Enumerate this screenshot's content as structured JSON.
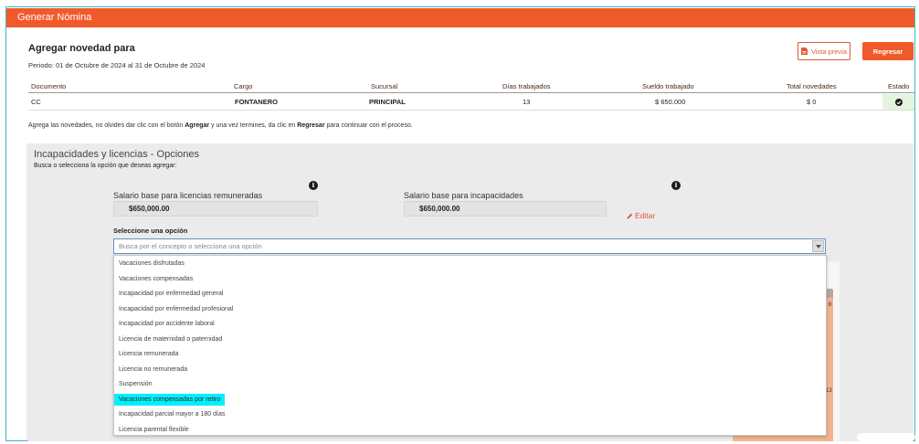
{
  "header": {
    "title": "Generar Nómina"
  },
  "summary": {
    "title": "Agregar novedad para",
    "period": "Periodo: 01 de Octubre de 2024 al 31 de Octubre de 2024",
    "preview_button": "Vista previa",
    "return_button": "Regresar"
  },
  "table": {
    "headers": [
      "Documento",
      "Cargo",
      "Sucursal",
      "Días trabajados",
      "Sueldo trabajado",
      "Total novedades",
      "Estado"
    ],
    "row": [
      "CC",
      "FONTANERO",
      "PRINCIPAL",
      "13",
      "$ 650.000",
      "$ 0"
    ],
    "status": "ok"
  },
  "note": {
    "part1": "Agrega las novedades, no olvides dar clic con el botón ",
    "agregar": "Agregar",
    "part2": " y una vez termines, da clic en ",
    "regresar": "Regresar",
    "part3": " para continuar con el proceso."
  },
  "panel": {
    "title": "Incapacidades y licencias - Opciones",
    "subtitle": "Busca o selecciona la opción que deseas agregar:",
    "salary_licenses_label": "Salario base para licencias remuneradas",
    "salary_licenses_value": "$650,000.00",
    "salary_disability_label": "Salario base para incapacidades",
    "salary_disability_value": "$650,000.00",
    "edit_label": "Editar",
    "select_label": "Seleccione una opción",
    "select_placeholder": "Busca por el concepto o selecciona una opción"
  },
  "options": [
    "Vacaciones disfrutadas",
    "Vacaciones compensadas",
    "Incapacidad por enfermedad general",
    "Incapacidad por enfermedad profesional",
    "Incapacidad por accidente laboral",
    "Licencia de maternidad o paternidad",
    "Licencia remunerada",
    "Licencia no remunerada",
    "Suspensión",
    "Vacaciones compensadas por retiro",
    "Incapacidad parcial mayor a 180 días",
    "Licencia parental flexible"
  ],
  "highlighted_option": "Vacaciones compensadas por retiro",
  "background_numbers": [
    "6",
    "13"
  ],
  "colors": {
    "accent": "#f05a2a",
    "highlight": "#00f0ff",
    "frame": "#3cb8c2"
  }
}
